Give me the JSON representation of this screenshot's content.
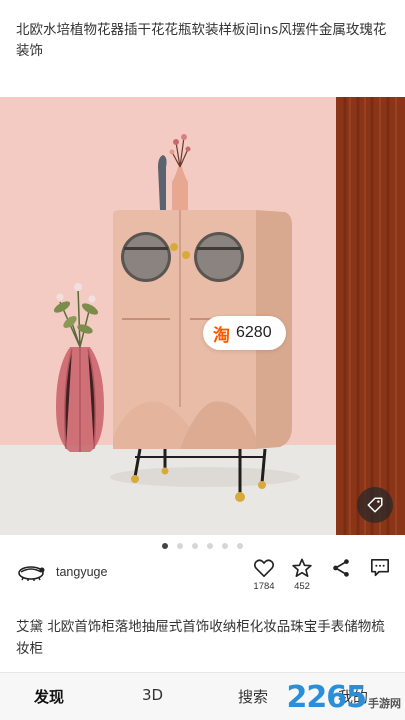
{
  "post": {
    "title": "北欧水培植物花器插干花花瓶软装样板间ins风摆件金属玫瑰花装饰",
    "price": "6280",
    "price_icon": "淘",
    "description": "艾黛 北欧首饰柜落地抽屉式首饰收纳柜化妆品珠宝手表储物梳妆柜"
  },
  "carousel": {
    "total": 6,
    "active": 0
  },
  "author": {
    "name": "tangyuge"
  },
  "actions": {
    "likes": "1784",
    "stars": "452"
  },
  "tabs": [
    {
      "label": "发现",
      "active": true
    },
    {
      "label": "3D",
      "active": false
    },
    {
      "label": "搜索",
      "active": false
    },
    {
      "label": "我的",
      "active": false
    }
  ],
  "watermark": {
    "number": "2265",
    "text": "手游网"
  },
  "colors": {
    "wall": "#f3c9c1",
    "cabinet": "#e3b6a0",
    "curtain": "#8a3418",
    "taobao": "#ff5a00",
    "watermark": "#2a8fd8"
  }
}
